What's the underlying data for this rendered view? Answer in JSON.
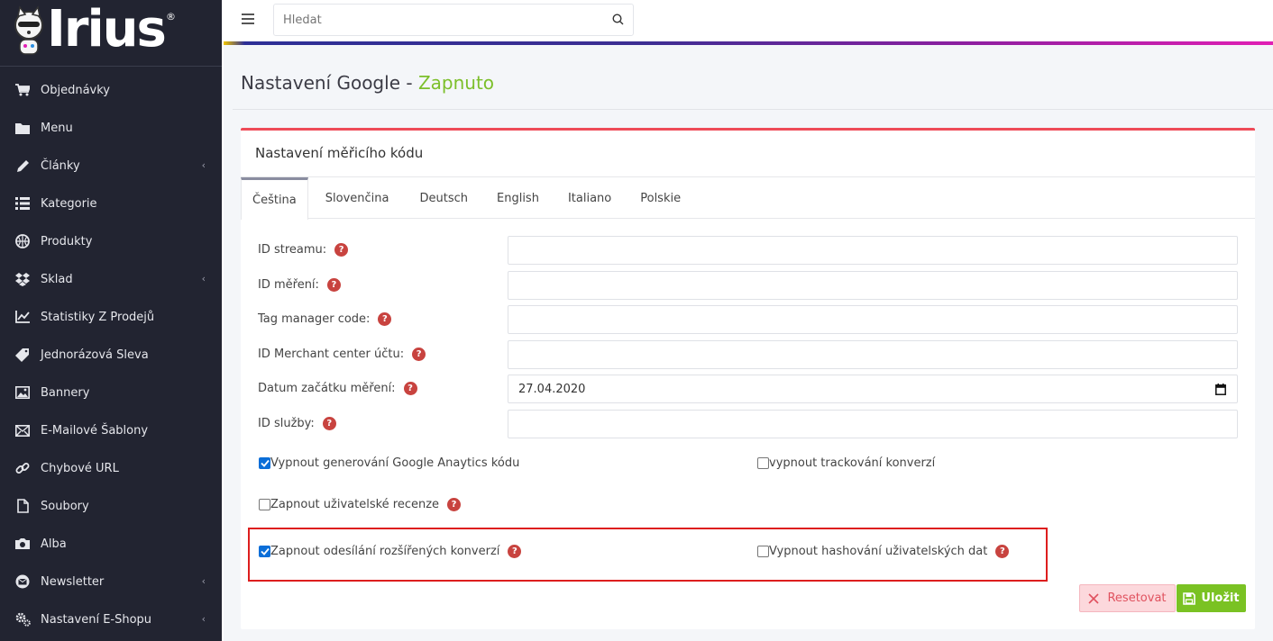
{
  "brand": {
    "logo_text": "Irius",
    "reg_mark": "®"
  },
  "search": {
    "placeholder": "Hledat"
  },
  "sidebar": {
    "items": [
      {
        "label": "Objednávky",
        "icon": "cart-icon"
      },
      {
        "label": "Menu",
        "icon": "folder-icon"
      },
      {
        "label": "Články",
        "icon": "pencil-icon",
        "chevron": "‹"
      },
      {
        "label": "Kategorie",
        "icon": "list-icon"
      },
      {
        "label": "Produkty",
        "icon": "basketball-icon"
      },
      {
        "label": "Sklad",
        "icon": "dropbox-icon",
        "chevron": "‹"
      },
      {
        "label": "Statistiky Z Prodejů",
        "icon": "line-chart-icon"
      },
      {
        "label": "Jednorázová Sleva",
        "icon": "tag-icon"
      },
      {
        "label": "Bannery",
        "icon": "image-icon"
      },
      {
        "label": "E-Mailové Šablony",
        "icon": "envelope-icon"
      },
      {
        "label": "Chybové URL",
        "icon": "link-icon"
      },
      {
        "label": "Soubory",
        "icon": "file-icon"
      },
      {
        "label": "Alba",
        "icon": "camera-icon"
      },
      {
        "label": "Newsletter",
        "icon": "envelope-circle-icon",
        "chevron": "‹"
      },
      {
        "label": "Nastavení E-Shopu",
        "icon": "cogs-icon",
        "chevron": "‹"
      }
    ]
  },
  "page": {
    "title": "Nastavení Google - ",
    "status": "Zapnuto"
  },
  "card": {
    "title": "Nastavení měřicího kódu",
    "tabs": [
      "Čeština",
      "Slovenčina",
      "Deutsch",
      "English",
      "Italiano",
      "Polskie"
    ],
    "fields": [
      {
        "label": "ID streamu:",
        "value": ""
      },
      {
        "label": "ID měření:",
        "value": ""
      },
      {
        "label": "Tag manager code:",
        "value": ""
      },
      {
        "label": "ID Merchant center účtu:",
        "value": ""
      },
      {
        "label": "Datum začátku měření:",
        "value": "27.04.2020"
      },
      {
        "label": "ID služby:",
        "value": ""
      }
    ],
    "checks": {
      "disable_ga": {
        "label": "Vypnout generování Google Anaytics kódu",
        "checked": true
      },
      "disable_conversion": {
        "label": "vypnout trackování konverzí",
        "checked": false
      },
      "enable_reviews": {
        "label": "Zapnout uživatelské recenze",
        "checked": false
      },
      "enable_enhanced": {
        "label": "Zapnout odesílání rozšířených konverzí",
        "checked": true
      },
      "disable_hashing": {
        "label": "Vypnout hashování uživatelských dat",
        "checked": false
      }
    },
    "buttons": {
      "reset": "Resetovat",
      "save": "Uložit"
    }
  },
  "colors": {
    "sidebar_bg": "#222431",
    "accent_green": "#7cbf2a",
    "card_top": "#ee4b58",
    "help_icon": "#c8433f"
  }
}
